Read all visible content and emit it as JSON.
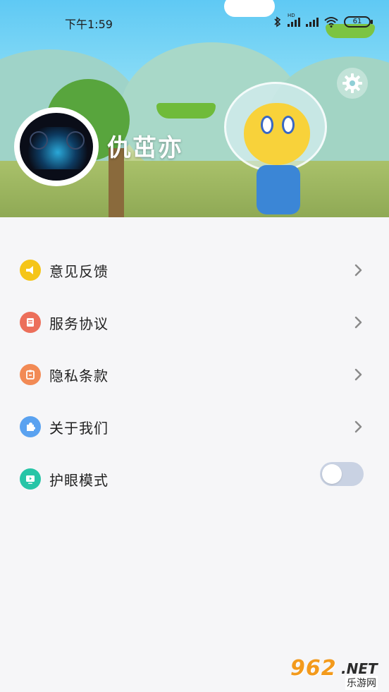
{
  "status_bar": {
    "time": "下午1:59",
    "network_label": "HD",
    "battery": "61"
  },
  "profile": {
    "username": "仇茁亦"
  },
  "menu": {
    "items": [
      {
        "label": "意见反馈",
        "icon": "megaphone-icon",
        "color": "#f5c518"
      },
      {
        "label": "服务协议",
        "icon": "document-icon",
        "color": "#ec6f5b"
      },
      {
        "label": "隐私条款",
        "icon": "clipboard-icon",
        "color": "#f28a55"
      },
      {
        "label": "关于我们",
        "icon": "puzzle-icon",
        "color": "#5aa2f0"
      },
      {
        "label": "护眼模式",
        "icon": "screen-icon",
        "color": "#27c5a7"
      }
    ],
    "eye_protection_enabled": false
  },
  "watermark": {
    "number": "962",
    "domain": ".NET",
    "site": "乐游网"
  }
}
